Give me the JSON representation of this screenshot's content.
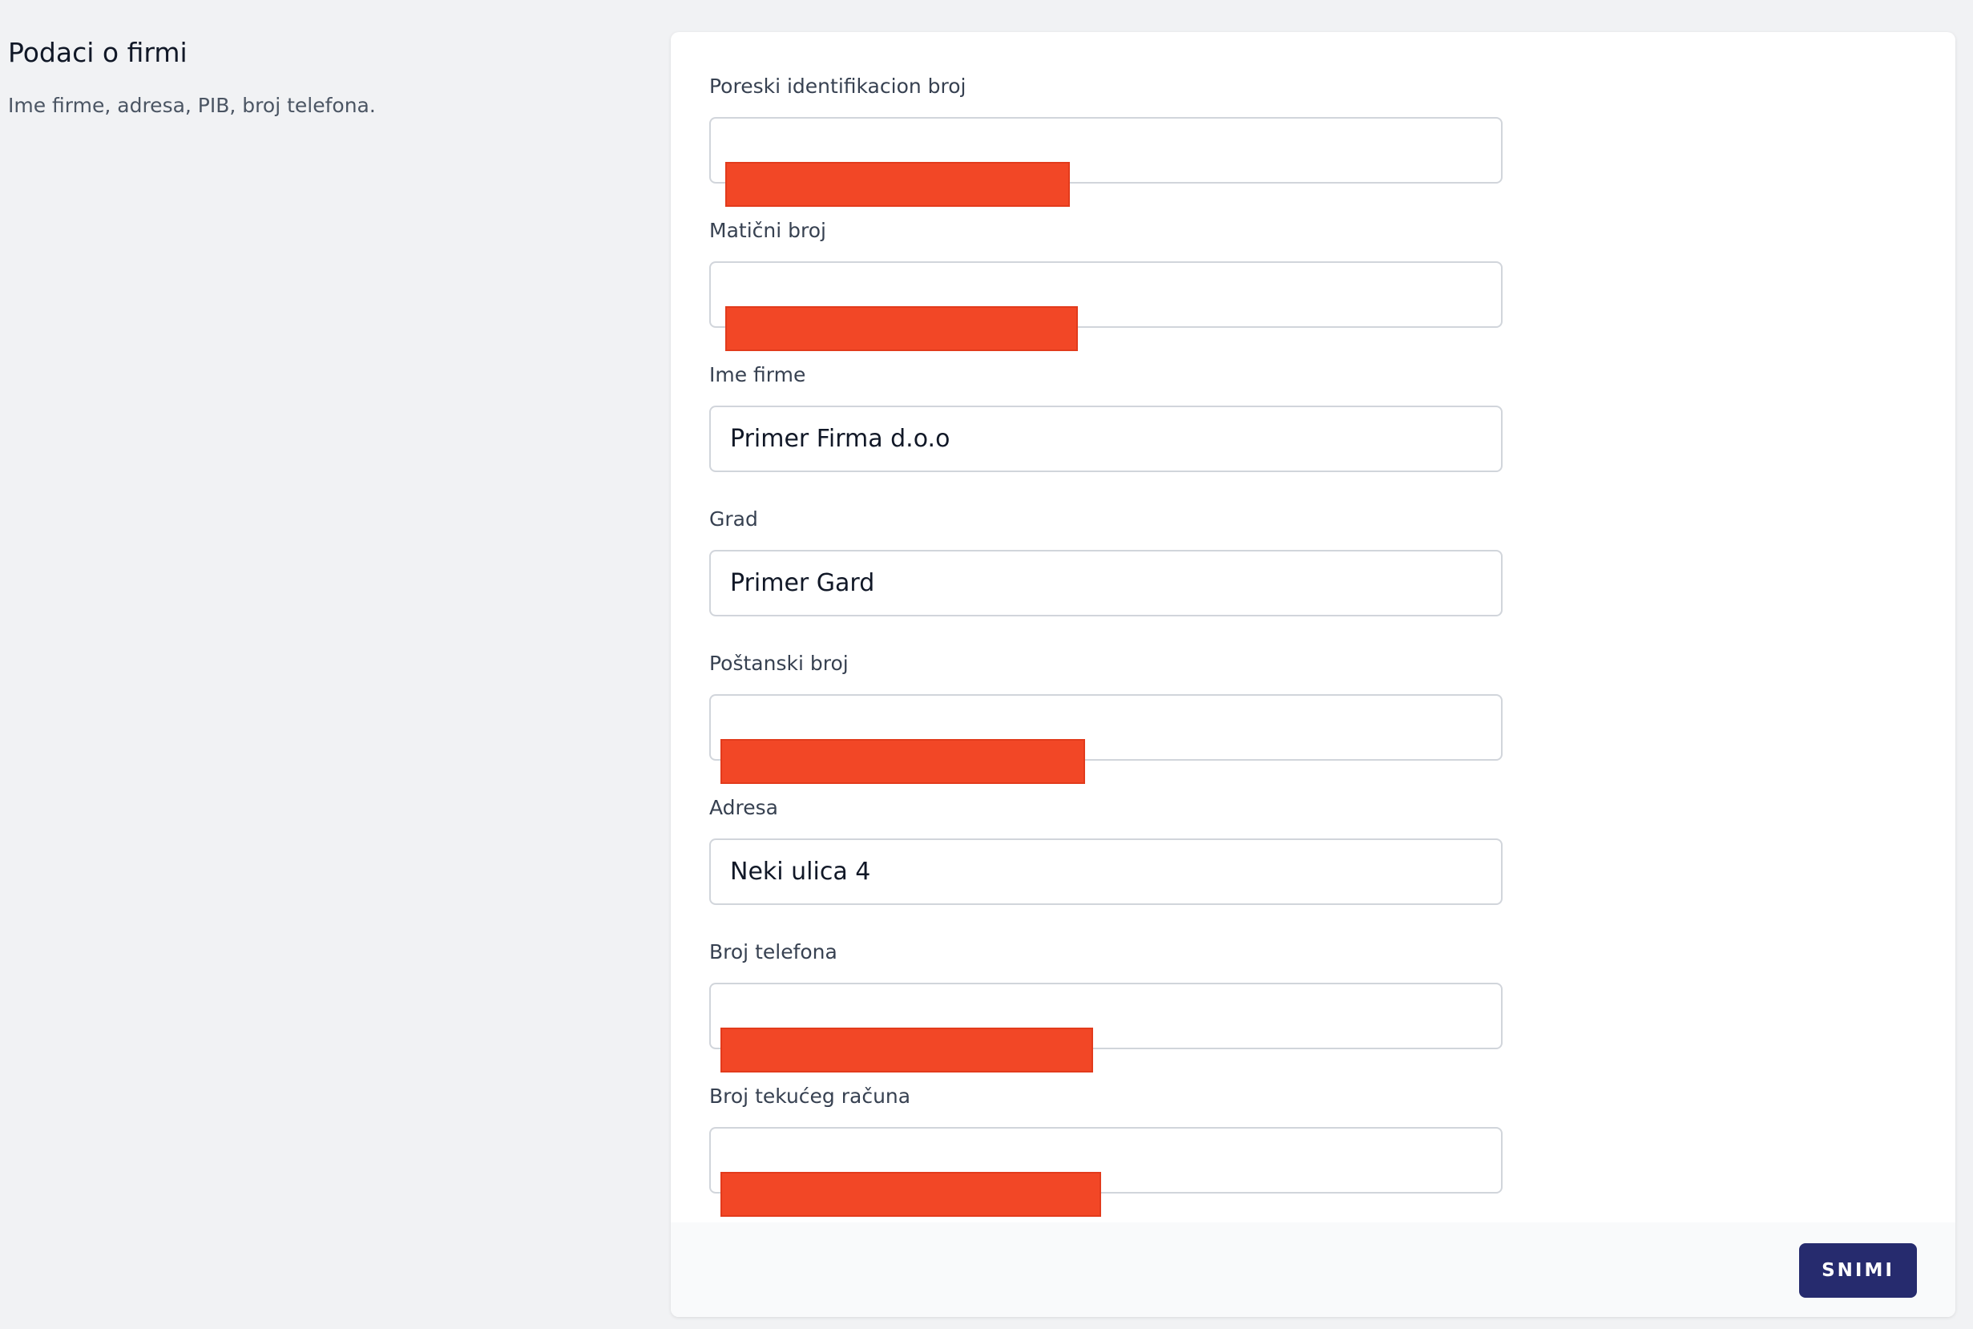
{
  "section": {
    "title": "Podaci o firmi",
    "description": "Ime firme, adresa, PIB, broj telefona."
  },
  "form": {
    "fields": [
      {
        "label": "Poreski identifikacion broj",
        "value": "",
        "redacted": true
      },
      {
        "label": "Matični broj",
        "value": "",
        "redacted": true
      },
      {
        "label": "Ime firme",
        "value": "Primer Firma d.o.o",
        "redacted": false
      },
      {
        "label": "Grad",
        "value": "Primer Gard",
        "redacted": false
      },
      {
        "label": "Poštanski broj",
        "value": "",
        "redacted": true
      },
      {
        "label": "Adresa",
        "value": "Neki ulica 4",
        "redacted": false
      },
      {
        "label": "Broj telefona",
        "value": "",
        "redacted": true
      },
      {
        "label": "Broj tekućeg računa",
        "value": "",
        "redacted": true
      }
    ]
  },
  "footer": {
    "save_label": "SNIMI"
  },
  "colors": {
    "page_background": "#f1f2f4",
    "redaction": "#f24726",
    "button_background": "#262b6e"
  }
}
